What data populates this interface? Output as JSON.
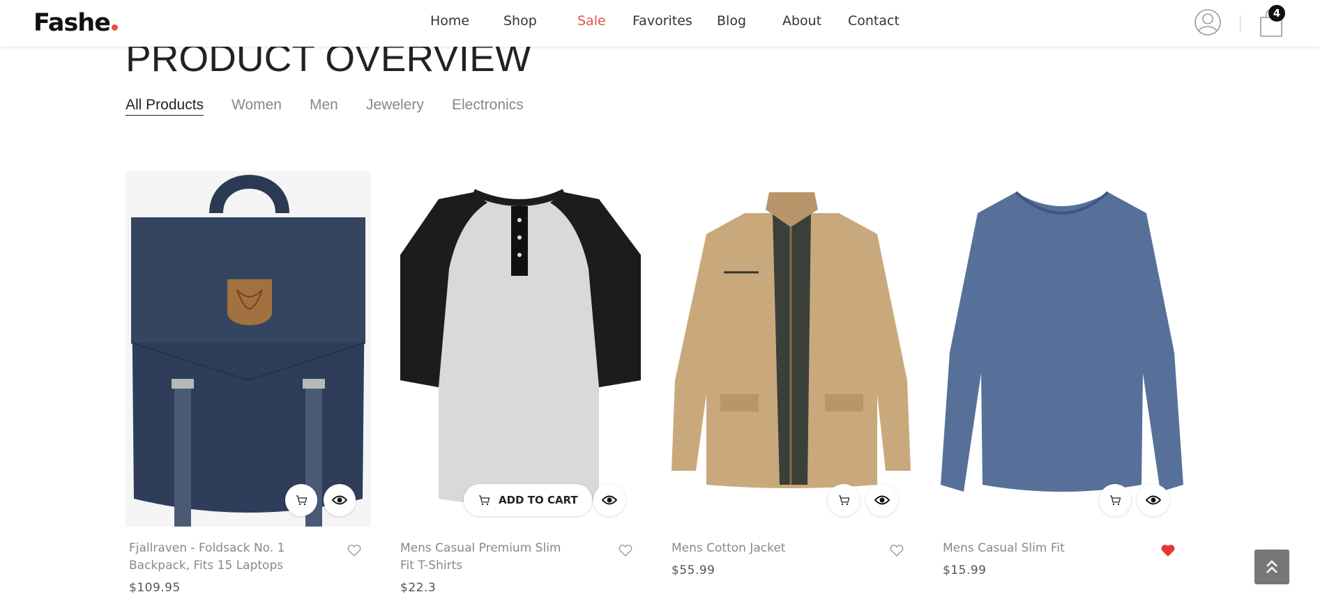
{
  "brand": {
    "name": "Fashe",
    "dot_color": "#e65540"
  },
  "nav": {
    "items": [
      {
        "label": "Home"
      },
      {
        "label": "Shop"
      },
      {
        "label": "Sale",
        "color": "#e65540"
      },
      {
        "label": "Favorites"
      },
      {
        "label": "Blog"
      },
      {
        "label": "About"
      },
      {
        "label": "Contact"
      }
    ]
  },
  "header": {
    "cart_count": "4",
    "user_icon": "user-icon",
    "cart_icon": "shopping-bag-icon"
  },
  "section": {
    "title": "PRODUCT OVERVIEW"
  },
  "filters": {
    "items": [
      "All Products",
      "Women",
      "Men",
      "Jewelery",
      "Electronics"
    ],
    "active": "All Products"
  },
  "products": [
    {
      "name": "Fjallraven - Foldsack No. 1 Backpack, Fits 15 Laptops",
      "price": "$109.95",
      "favorited": false,
      "hovered": false,
      "image": "navy backpack with leather badge"
    },
    {
      "name": "Mens Casual Premium Slim Fit T-Shirts",
      "price": "$22.3",
      "favorited": false,
      "hovered": true,
      "image": "raglan henley t-shirt"
    },
    {
      "name": "Mens Cotton Jacket",
      "price": "$55.99",
      "favorited": false,
      "hovered": false,
      "image": "khaki cotton jacket"
    },
    {
      "name": "Mens Casual Slim Fit",
      "price": "$15.99",
      "favorited": true,
      "hovered": false,
      "image": "blue long sleeve v-neck"
    }
  ],
  "actions": {
    "add_to_cart": "ADD TO CART"
  },
  "colors": {
    "accent": "#e65540",
    "favorite": "#e53935",
    "scroll_top_bg": "#777777"
  }
}
